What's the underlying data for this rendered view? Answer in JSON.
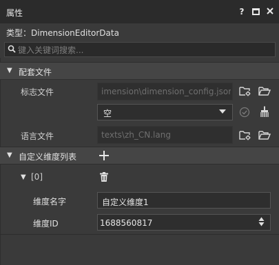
{
  "panel": {
    "title": "属性",
    "help_label": "?",
    "type_line": "类型：DimensionEditorData",
    "search_placeholder": "键入关键词搜索..."
  },
  "sections": {
    "config_files": {
      "label": "配套文件",
      "flag_file_label": "标志文件",
      "flag_file_value": "imension\\dimension_config.json",
      "dropdown_value": "空",
      "lang_file_label": "语言文件",
      "lang_file_value": "texts\\zh_CN.lang"
    },
    "custom_dimension_list": {
      "label": "自定义维度列表",
      "item_label": "[0]",
      "name_label": "维度名字",
      "name_value": "自定义维度1",
      "id_label": "维度ID",
      "id_value": "1688560817"
    }
  },
  "icons": {
    "window": [
      "help-icon",
      "maximize-icon",
      "close-icon"
    ],
    "field_actions": [
      "folder-settings-icon",
      "folder-open-icon",
      "check-circle-icon",
      "broom-icon",
      "trash-icon",
      "plus-icon",
      "caret-down-icon",
      "stepper-icon"
    ]
  },
  "colors": {
    "background": "#3a3a3a",
    "titlebar": "#2b2b2b",
    "section": "#454545",
    "field": "#2f2f2f",
    "text": "#d8d8d8",
    "dim_text": "#6f6f6f"
  }
}
